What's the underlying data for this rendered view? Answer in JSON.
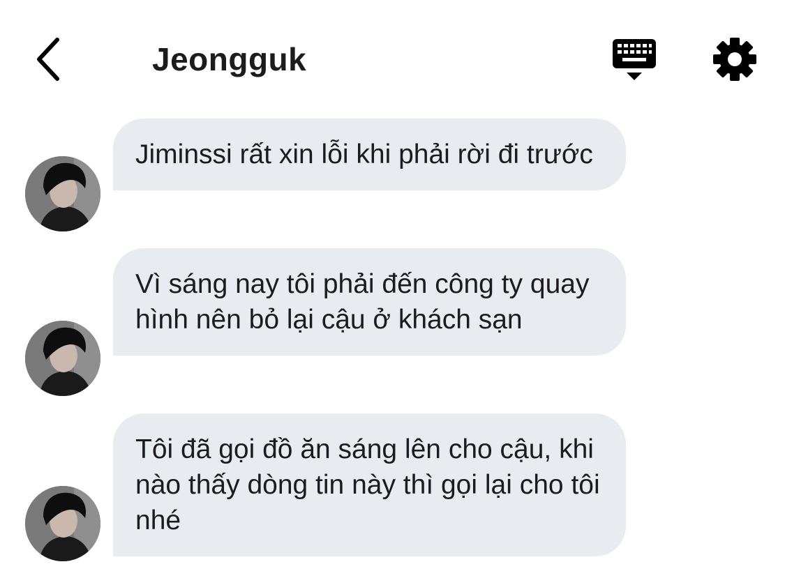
{
  "header": {
    "back_icon": "chevron-left-icon",
    "title": "Jeongguk",
    "keyboard_icon": "keyboard-hide-icon",
    "settings_icon": "gear-icon"
  },
  "messages": [
    {
      "sender": "Jeongguk",
      "text": "Jiminssi rất xin lỗi khi phải rời đi trước"
    },
    {
      "sender": "Jeongguk",
      "text": "Vì sáng nay tôi phải đến công ty quay hình nên bỏ lại cậu ở khách sạn"
    },
    {
      "sender": "Jeongguk",
      "text": "Tôi đã gọi đồ ăn sáng lên cho cậu, khi nào thấy dòng tin này thì gọi lại cho tôi nhé"
    }
  ],
  "colors": {
    "bubble_bg": "#e8ebf0",
    "text": "#1c1c1e",
    "background": "#ffffff"
  }
}
